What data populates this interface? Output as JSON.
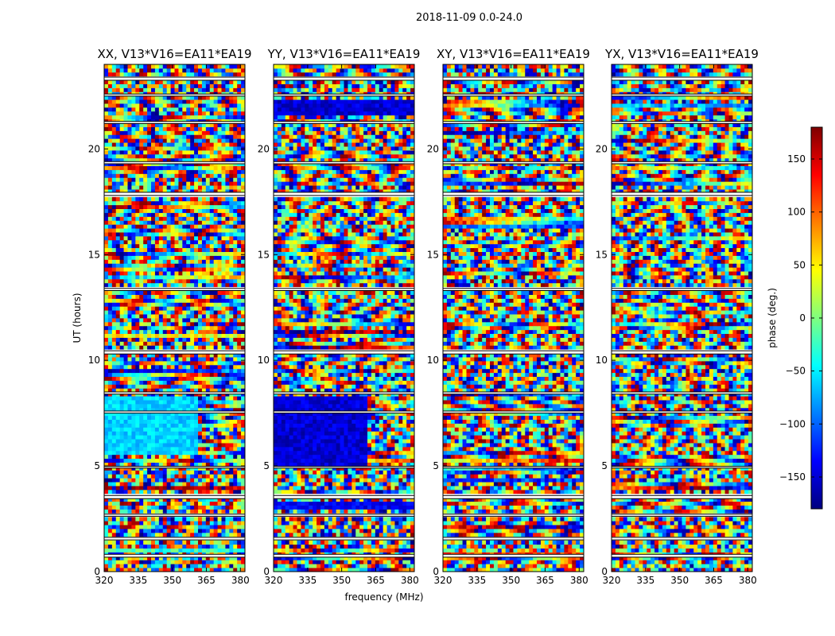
{
  "figure": {
    "suptitle": "2018-11-09 0.0-24.0",
    "xlabel": "frequency (MHz)",
    "ylabel": "UT (hours)"
  },
  "colorbar": {
    "label": "phase (deg.)",
    "range": [
      -180,
      180
    ],
    "ticks": [
      150,
      100,
      50,
      0,
      -50,
      -100,
      -150
    ],
    "tick_labels": [
      "150",
      "100",
      "50",
      "0",
      "−50",
      "−100",
      "−150"
    ],
    "colormap": "jet",
    "colors": [
      "#00007f",
      "#0000ff",
      "#007fff",
      "#00ffff",
      "#7fff7f",
      "#ffff00",
      "#ff7f00",
      "#ff0000",
      "#7f0000"
    ]
  },
  "chart_data": {
    "type": "heatmap",
    "title": "2018-11-09 0.0-24.0",
    "xlabel": "frequency (MHz)",
    "ylabel": "UT (hours)",
    "xlim": [
      320,
      382
    ],
    "ylim": [
      0,
      24
    ],
    "xticks": [
      320,
      335,
      350,
      365,
      380
    ],
    "yticks": [
      0,
      5,
      10,
      15,
      20
    ],
    "value_label": "phase (deg.)",
    "value_range": [
      -180,
      180
    ],
    "panels": [
      {
        "title": "XX, V13*V16=EA11*EA19",
        "polarization": "XX"
      },
      {
        "title": "YY, V13*V16=EA11*EA19",
        "polarization": "YY"
      },
      {
        "title": "XY, V13*V16=EA11*EA19",
        "polarization": "XY"
      },
      {
        "title": "YX, V13*V16=EA11*EA19",
        "polarization": "YX"
      }
    ],
    "flagged_gaps_hours": [
      [
        0.68,
        0.82
      ],
      [
        1.5,
        1.62
      ],
      [
        2.62,
        2.72
      ],
      [
        3.45,
        3.6
      ],
      [
        4.9,
        4.98
      ],
      [
        7.5,
        7.6
      ],
      [
        8.4,
        8.5
      ],
      [
        10.3,
        10.45
      ],
      [
        13.3,
        13.4
      ],
      [
        17.8,
        17.95
      ],
      [
        19.3,
        19.4
      ],
      [
        21.2,
        21.3
      ],
      [
        22.5,
        22.6
      ],
      [
        23.25,
        23.4
      ]
    ],
    "uniform_regions": [
      {
        "panel": "XX",
        "t_range": [
          5.6,
          8.3
        ],
        "f_range": [
          320,
          362
        ],
        "phase_mean": -60
      },
      {
        "panel": "YY",
        "t_range": [
          5.0,
          8.3
        ],
        "f_range": [
          320,
          362
        ],
        "phase_mean": -150
      },
      {
        "panel": "YY",
        "t_range": [
          3.0,
          3.4
        ],
        "f_range": [
          320,
          382
        ],
        "phase_mean": -140
      },
      {
        "panel": "YY",
        "t_range": [
          21.6,
          22.3
        ],
        "f_range": [
          320,
          382
        ],
        "phase_mean": -150
      }
    ]
  }
}
